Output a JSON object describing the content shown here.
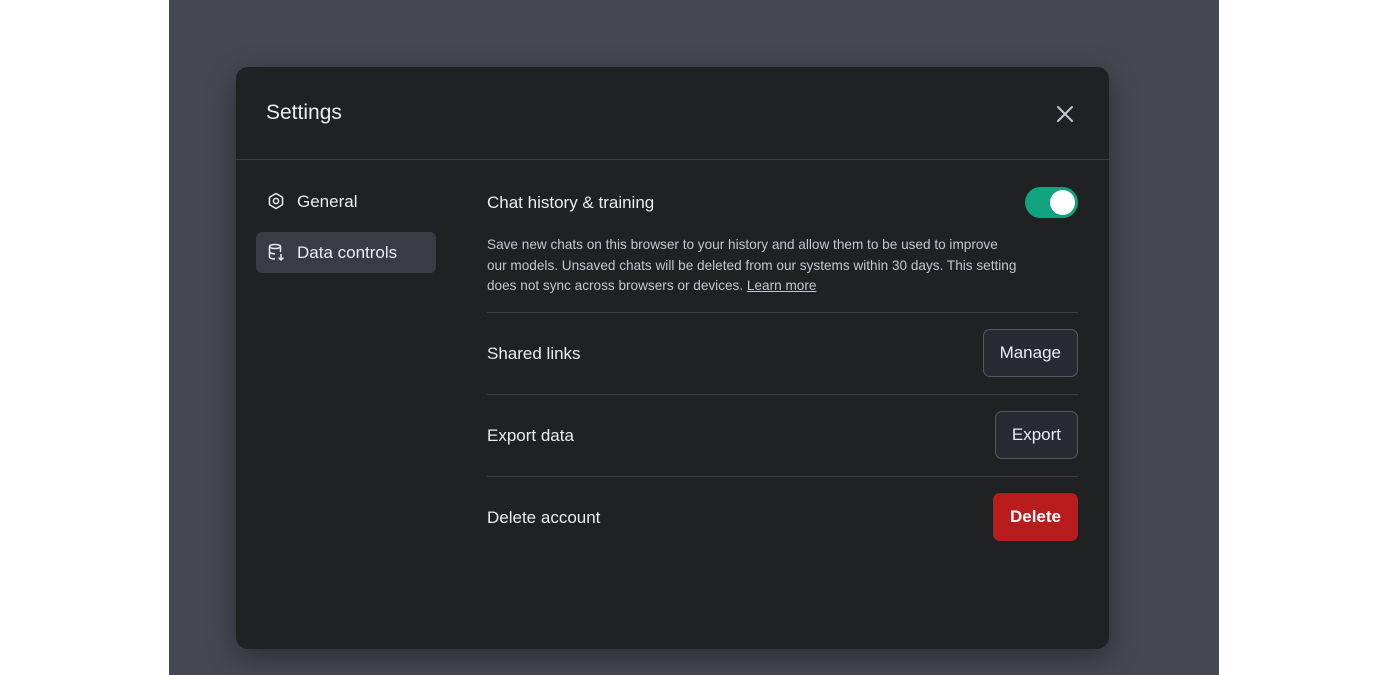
{
  "modal": {
    "title": "Settings"
  },
  "sidebar": {
    "items": [
      {
        "label": "General",
        "icon": "gear-icon",
        "active": false
      },
      {
        "label": "Data controls",
        "icon": "database-icon",
        "active": true
      }
    ]
  },
  "data_controls": {
    "chat_history": {
      "label": "Chat history & training",
      "description": "Save new chats on this browser to your history and allow them to be used to improve our models. Unsaved chats will be deleted from our systems within 30 days. This setting does not sync across browsers or devices.",
      "learn_more": "Learn more",
      "enabled": true
    },
    "shared_links": {
      "label": "Shared links",
      "button": "Manage"
    },
    "export_data": {
      "label": "Export data",
      "button": "Export"
    },
    "delete_account": {
      "label": "Delete account",
      "button": "Delete"
    }
  },
  "colors": {
    "accent_toggle": "#10a37f",
    "danger": "#b91c1c",
    "modal_bg": "#202123",
    "backdrop": "#454752"
  }
}
